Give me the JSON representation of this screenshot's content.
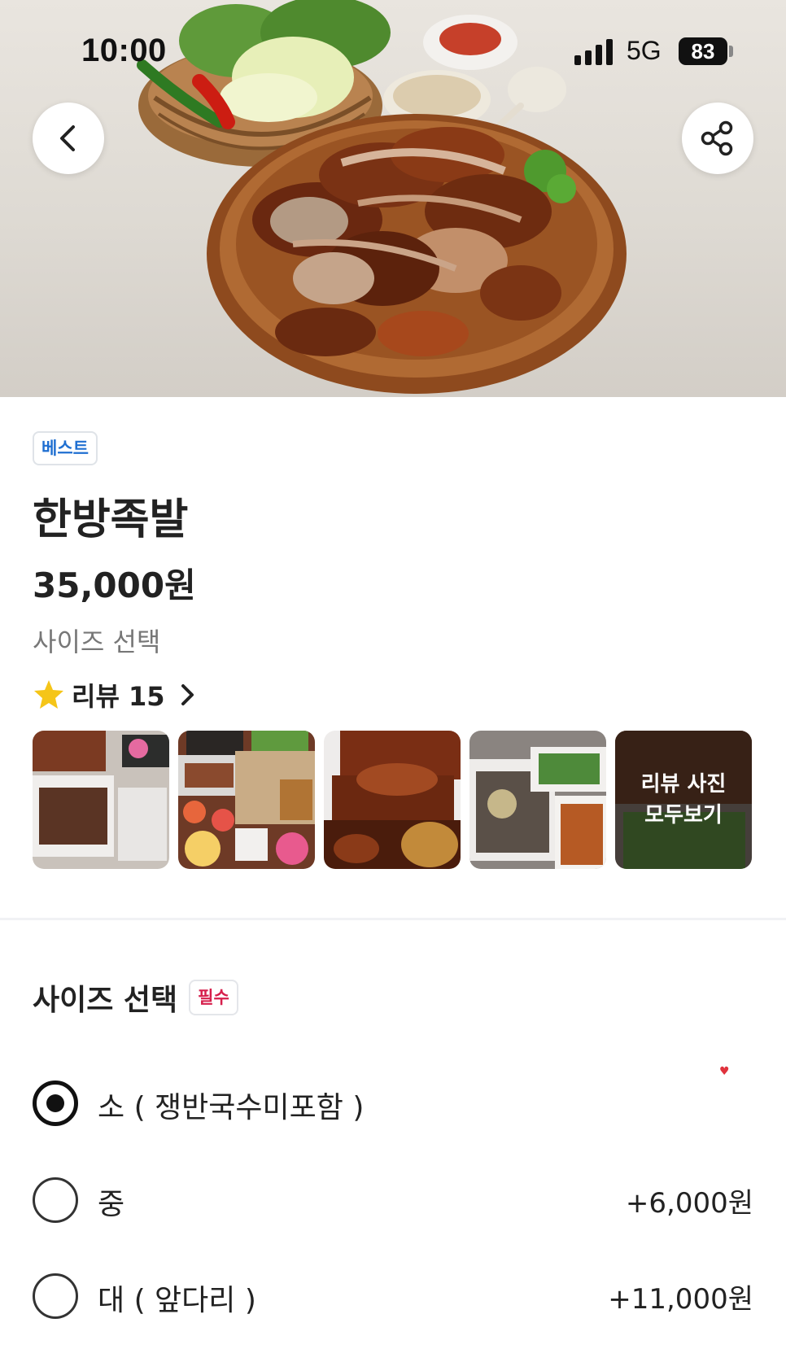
{
  "status_bar": {
    "time": "10:00",
    "network": "5G",
    "battery": "83"
  },
  "hero": {
    "icons": {
      "back": "chevron-left-icon",
      "share": "share-icon"
    }
  },
  "product": {
    "badge": "베스트",
    "name": "한방족발",
    "price": "35,000원",
    "subtitle": "사이즈 선택"
  },
  "reviews": {
    "label": "리뷰 15",
    "more_line1": "리뷰 사진",
    "more_line2": "모두보기"
  },
  "options_section": {
    "title": "사이즈 선택",
    "required_badge": "필수",
    "heart": "♥",
    "options": [
      {
        "label": "소 ( 쟁반국수미포함 )",
        "price": "",
        "selected": true
      },
      {
        "label": "중",
        "price": "+6,000원",
        "selected": false
      },
      {
        "label": "대 ( 앞다리 )",
        "price": "+11,000원",
        "selected": false
      }
    ]
  },
  "colors": {
    "badge_blue": "#1f6fd1",
    "required_red": "#d61f4c",
    "text": "#222222",
    "muted": "#777777"
  }
}
